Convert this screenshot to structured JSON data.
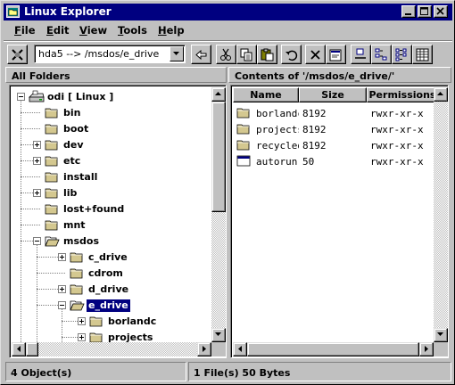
{
  "window": {
    "title": "Linux Explorer",
    "title_bar_color": "#000080",
    "buttons": [
      "minimize-icon",
      "maximize-icon",
      "close-icon"
    ]
  },
  "menubar": {
    "items": [
      {
        "label": "File",
        "mnemonic": "F",
        "rest": "ile"
      },
      {
        "label": "Edit",
        "mnemonic": "E",
        "rest": "dit"
      },
      {
        "label": "View",
        "mnemonic": "V",
        "rest": "iew"
      },
      {
        "label": "Tools",
        "mnemonic": "T",
        "rest": "ools"
      },
      {
        "label": "Help",
        "mnemonic": "H",
        "rest": "elp"
      }
    ]
  },
  "toolbar": {
    "path_combo_value": "hda5 --> /msdos/e_drive",
    "icons": [
      "disconnect-icon",
      "up-folder-icon",
      "cut-icon",
      "copy-icon",
      "paste-icon",
      "undo-icon",
      "delete-icon",
      "properties-icon",
      "large-icons-icon",
      "small-icons-icon",
      "list-view-icon",
      "details-view-icon"
    ]
  },
  "left_pane": {
    "header": "All Folders",
    "tree": [
      {
        "label": "odi [ Linux ]",
        "level": 0,
        "expander": "minus",
        "icon": "drive-icon"
      },
      {
        "label": "bin",
        "level": 1,
        "expander": "none",
        "icon": "folder-icon"
      },
      {
        "label": "boot",
        "level": 1,
        "expander": "none",
        "icon": "folder-icon"
      },
      {
        "label": "dev",
        "level": 1,
        "expander": "plus",
        "icon": "folder-icon"
      },
      {
        "label": "etc",
        "level": 1,
        "expander": "plus",
        "icon": "folder-icon"
      },
      {
        "label": "install",
        "level": 1,
        "expander": "none",
        "icon": "folder-icon"
      },
      {
        "label": "lib",
        "level": 1,
        "expander": "plus",
        "icon": "folder-icon"
      },
      {
        "label": "lost+found",
        "level": 1,
        "expander": "none",
        "icon": "folder-icon"
      },
      {
        "label": "mnt",
        "level": 1,
        "expander": "none",
        "icon": "folder-icon"
      },
      {
        "label": "msdos",
        "level": 1,
        "expander": "minus",
        "icon": "open-folder-icon"
      },
      {
        "label": "c_drive",
        "level": 2,
        "expander": "plus",
        "icon": "folder-icon"
      },
      {
        "label": "cdrom",
        "level": 2,
        "expander": "none",
        "icon": "folder-icon"
      },
      {
        "label": "d_drive",
        "level": 2,
        "expander": "plus",
        "icon": "folder-icon"
      },
      {
        "label": "e_drive",
        "level": 2,
        "expander": "minus",
        "icon": "open-folder-icon",
        "selected": true
      },
      {
        "label": "borlandc",
        "level": 3,
        "expander": "plus",
        "icon": "folder-icon"
      },
      {
        "label": "projects",
        "level": 3,
        "expander": "plus",
        "icon": "folder-icon"
      }
    ]
  },
  "right_pane": {
    "header": "Contents of '/msdos/e_drive/'",
    "columns": [
      "Name",
      "Size",
      "Permissions"
    ],
    "rows": [
      {
        "name": "borlandc",
        "size": "8192",
        "perm": "rwxr-xr-x",
        "icon": "folder-icon"
      },
      {
        "name": "projects",
        "size": "8192",
        "perm": "rwxr-xr-x",
        "icon": "folder-icon"
      },
      {
        "name": "recycled",
        "size": "8192",
        "perm": "rwxr-xr-x",
        "icon": "folder-icon"
      },
      {
        "name": "autorun.in",
        "size": "50",
        "perm": "rwxr-xr-x",
        "icon": "file-window-icon"
      }
    ]
  },
  "statusbar": {
    "left": "4 Object(s)",
    "right": "1 File(s) 50 Bytes"
  }
}
